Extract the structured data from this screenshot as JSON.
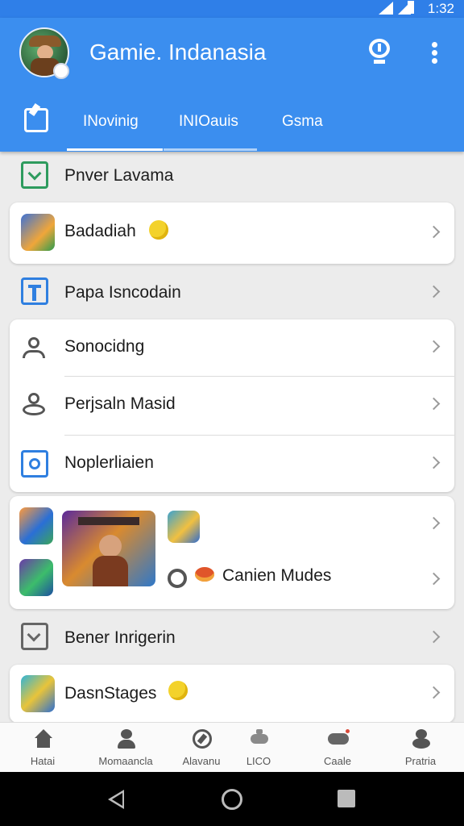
{
  "status": {
    "time": "1:32"
  },
  "app": {
    "title": "Gamie. Indanasia"
  },
  "tabs": [
    {
      "label": "INovinig"
    },
    {
      "label": "INIOauis"
    },
    {
      "label": "Gsma"
    }
  ],
  "list": {
    "row1": {
      "label": "Pnver Lavama"
    },
    "row2": {
      "label": "Badadiah"
    },
    "row3": {
      "label": "Papa Isncodain"
    },
    "group": [
      {
        "label": "Sonocidng"
      },
      {
        "label": "Perjsaln Masid"
      },
      {
        "label": "Noplerliaien"
      }
    ],
    "media": {
      "label": "Canien Mudes"
    },
    "row4": {
      "label": "Bener Inrigerin"
    },
    "row5": {
      "label": "DasnStages"
    }
  },
  "bottom_nav": [
    {
      "label": "Hatai",
      "icon": "home-icon"
    },
    {
      "label": "Momaancla",
      "icon": "people-icon"
    },
    {
      "label": "Alavanu",
      "icon": "compass-icon"
    },
    {
      "label": "LICO",
      "icon": "gamepad-icon"
    },
    {
      "label": "Caale",
      "icon": "controller-icon"
    },
    {
      "label": "Pratria",
      "icon": "profile-icon"
    }
  ],
  "colors": {
    "primary": "#3b8eef",
    "background": "#ececec",
    "card": "#ffffff"
  }
}
